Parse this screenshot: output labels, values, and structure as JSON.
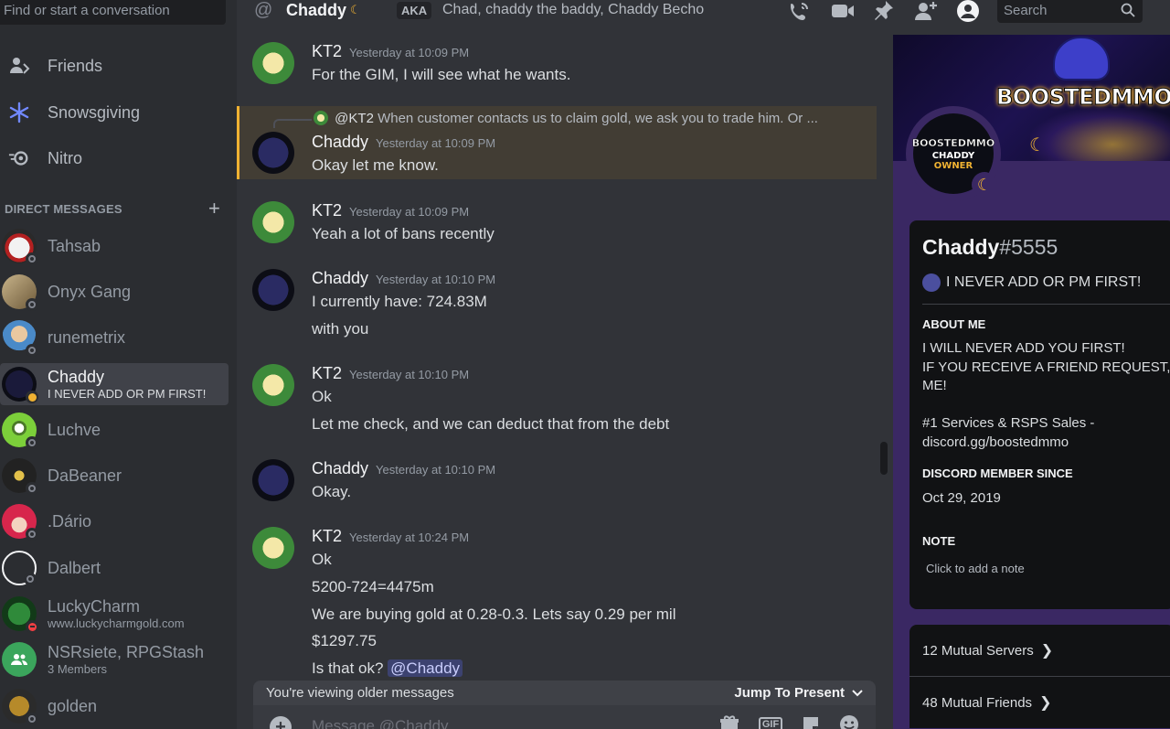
{
  "sidebar": {
    "search_placeholder": "Find or start a conversation",
    "nav": [
      {
        "label": "Friends",
        "icon": "friends-icon"
      },
      {
        "label": "Snowsgiving",
        "icon": "snowflake-icon"
      },
      {
        "label": "Nitro",
        "icon": "nitro-icon"
      }
    ],
    "dm_header": "DIRECT MESSAGES",
    "dms": [
      {
        "name": "Tahsab",
        "sub": ""
      },
      {
        "name": "Onyx Gang",
        "sub": ""
      },
      {
        "name": "runemetrix",
        "sub": ""
      },
      {
        "name": "Chaddy",
        "sub": "I NEVER ADD OR PM FIRST!"
      },
      {
        "name": "Luchve",
        "sub": ""
      },
      {
        "name": "DaBeaner",
        "sub": ""
      },
      {
        "name": ".Dário",
        "sub": ""
      },
      {
        "name": "Dalbert",
        "sub": ""
      },
      {
        "name": "LuckyCharm",
        "sub": "www.luckycharmgold.com"
      },
      {
        "name": "NSRsiete, RPGStash",
        "sub": "3 Members"
      },
      {
        "name": "golden",
        "sub": ""
      }
    ]
  },
  "topbar": {
    "channel_name": "Chaddy",
    "aka_label": "AKA",
    "nicknames": "Chad, chaddy the baddy, Chaddy Becho",
    "search_placeholder": "Search"
  },
  "chat": {
    "messages": [
      {
        "author": "KT2",
        "time": "Yesterday at 10:09 PM",
        "lines": [
          "For the GIM, I will see what he wants."
        ]
      },
      {
        "author": "Chaddy",
        "time": "Yesterday at 10:09 PM",
        "reply_to": "@KT2",
        "reply_text": "When customer contacts us to claim gold, we ask you to trade him. Or ...",
        "lines": [
          "Okay let me know."
        ]
      },
      {
        "author": "KT2",
        "time": "Yesterday at 10:09 PM",
        "lines": [
          "Yeah a lot of bans recently"
        ]
      },
      {
        "author": "Chaddy",
        "time": "Yesterday at 10:10 PM",
        "lines": [
          "I currently have: 724.83M",
          "with you"
        ]
      },
      {
        "author": "KT2",
        "time": "Yesterday at 10:10 PM",
        "lines": [
          "Ok",
          "Let me check, and we can deduct that from the debt"
        ]
      },
      {
        "author": "Chaddy",
        "time": "Yesterday at 10:10 PM",
        "lines": [
          "Okay."
        ]
      },
      {
        "author": "KT2",
        "time": "Yesterday at 10:24 PM",
        "lines": [
          "Ok",
          "5200-724=4475m",
          "We are buying gold at 0.28-0.3. Lets say 0.29 per mil",
          "$1297.75",
          "Is that ok?"
        ],
        "mention": "@Chaddy"
      }
    ],
    "older_notice": "You're viewing older messages",
    "jump_label": "Jump To Present",
    "composer_placeholder": "Message @Chaddy",
    "gif_label": "GIF"
  },
  "profile": {
    "banner_text": "BOOSTEDMMO",
    "avatar_lines": [
      "BOOSTEDMMO",
      "CHADDY",
      "OWNER"
    ],
    "username": "Chaddy",
    "discriminator": "#5555",
    "custom_status": "I NEVER ADD OR PM FIRST!",
    "about_header": "ABOUT ME",
    "about_lines": [
      "I WILL NEVER ADD YOU FIRST!",
      "IF YOU RECEIVE A FRIEND REQUEST, IT",
      "ME!",
      "",
      "#1 Services & RSPS Sales -",
      "discord.gg/boostedmmo"
    ],
    "member_since_header": "DISCORD MEMBER SINCE",
    "member_since": "Oct 29, 2019",
    "note_header": "NOTE",
    "note_placeholder": "Click to add a note",
    "mutual_servers": "12 Mutual Servers",
    "mutual_friends": "48 Mutual Friends"
  },
  "colors": {
    "accent_idle": "#f0b232",
    "mention_bg": "#3c4270",
    "profile_theme": "#3a2863"
  }
}
